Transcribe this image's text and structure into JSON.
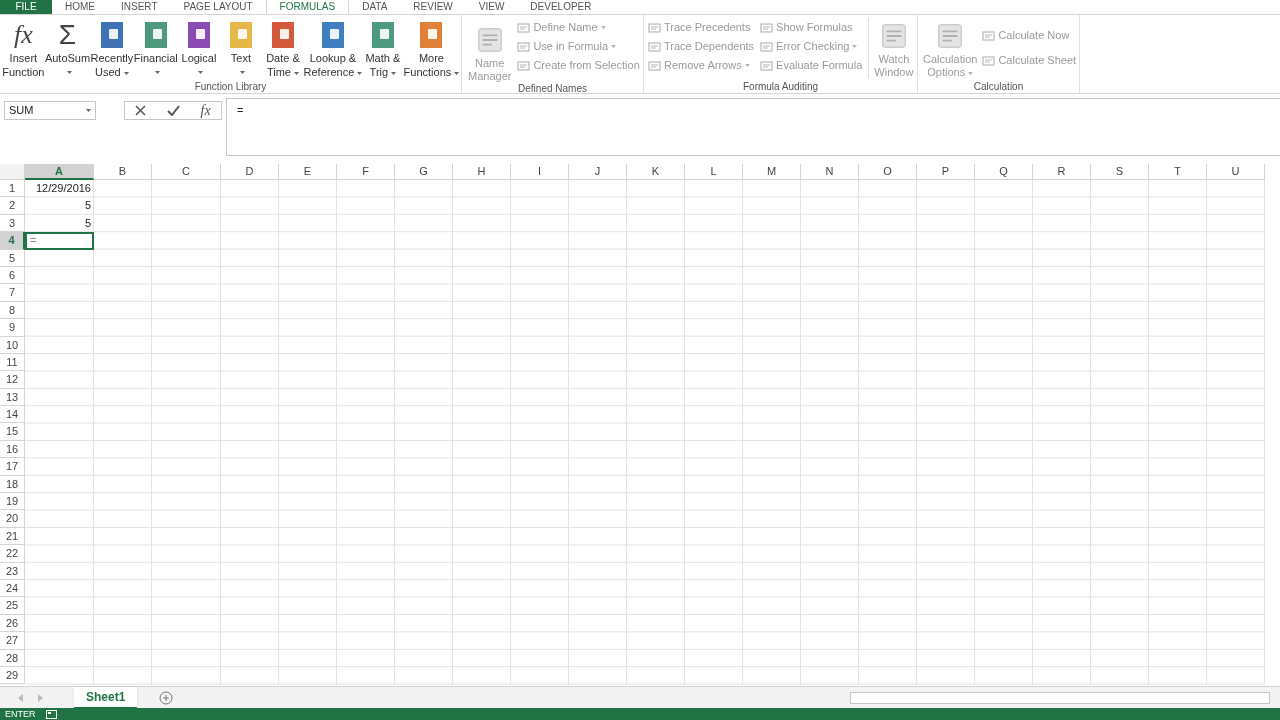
{
  "ribbon_tabs": [
    {
      "label": "FILE",
      "kind": "file",
      "selected": false
    },
    {
      "label": "HOME",
      "kind": "tab",
      "selected": false
    },
    {
      "label": "INSERT",
      "kind": "tab",
      "selected": false
    },
    {
      "label": "PAGE LAYOUT",
      "kind": "tab",
      "selected": false
    },
    {
      "label": "FORMULAS",
      "kind": "tab",
      "selected": true
    },
    {
      "label": "DATA",
      "kind": "tab",
      "selected": false
    },
    {
      "label": "REVIEW",
      "kind": "tab",
      "selected": false
    },
    {
      "label": "VIEW",
      "kind": "tab",
      "selected": false
    },
    {
      "label": "DEVELOPER",
      "kind": "tab",
      "selected": false
    }
  ],
  "function_library": {
    "title": "Function Library",
    "buttons": [
      {
        "lines": [
          "Insert",
          "Function"
        ],
        "dropdown": false,
        "kind": "function",
        "glyph": "fx"
      },
      {
        "lines": [
          "AutoSum"
        ],
        "dropdown": true,
        "kind": "sum",
        "glyph": "Σ"
      },
      {
        "lines": [
          "Recently",
          "Used"
        ],
        "dropdown": true,
        "kind": "category",
        "color": "#3f72b5"
      },
      {
        "lines": [
          "Financial"
        ],
        "dropdown": true,
        "kind": "category",
        "color": "#4e9a7e"
      },
      {
        "lines": [
          "Logical"
        ],
        "dropdown": true,
        "kind": "category",
        "color": "#8a4bb5"
      },
      {
        "lines": [
          "Text"
        ],
        "dropdown": true,
        "kind": "category",
        "color": "#e6b84a"
      },
      {
        "lines": [
          "Date &",
          "Time"
        ],
        "dropdown": true,
        "kind": "category",
        "color": "#d35a3c"
      },
      {
        "lines": [
          "Lookup &",
          "Reference"
        ],
        "dropdown": true,
        "kind": "category",
        "color": "#3f7fc0"
      },
      {
        "lines": [
          "Math &",
          "Trig"
        ],
        "dropdown": true,
        "kind": "category",
        "color": "#4e9a7e"
      },
      {
        "lines": [
          "More",
          "Functions"
        ],
        "dropdown": true,
        "kind": "category",
        "color": "#e0813a"
      }
    ]
  },
  "defined_names": {
    "title": "Defined Names",
    "large": {
      "lines": [
        "Name",
        "Manager"
      ],
      "disabled": true
    },
    "small": [
      {
        "label": "Define Name",
        "dropdown": true,
        "disabled": true
      },
      {
        "label": "Use in Formula",
        "dropdown": true,
        "disabled": true
      },
      {
        "label": "Create from Selection",
        "dropdown": false,
        "disabled": true
      }
    ]
  },
  "formula_auditing": {
    "title": "Formula Auditing",
    "small_columns": [
      [
        {
          "label": "Trace Precedents",
          "dropdown": false,
          "disabled": true
        },
        {
          "label": "Trace Dependents",
          "dropdown": false,
          "disabled": true
        },
        {
          "label": "Remove Arrows",
          "dropdown": true,
          "disabled": true
        }
      ],
      [
        {
          "label": "Show Formulas",
          "dropdown": false,
          "disabled": true
        },
        {
          "label": "Error Checking",
          "dropdown": true,
          "disabled": true
        },
        {
          "label": "Evaluate Formula",
          "dropdown": false,
          "disabled": true
        }
      ]
    ],
    "large": {
      "lines": [
        "Watch",
        "Window"
      ],
      "disabled": true
    }
  },
  "calculation": {
    "title": "Calculation",
    "large": {
      "lines": [
        "Calculation",
        "Options"
      ],
      "dropdown": true,
      "disabled": true
    },
    "small": [
      {
        "label": "Calculate Now",
        "disabled": true
      },
      {
        "label": "Calculate Sheet",
        "disabled": true
      }
    ]
  },
  "formula_bar": {
    "name_box": "SUM",
    "fx_glyph": "fx",
    "formula": "="
  },
  "columns": [
    {
      "label": "A",
      "selected": true
    },
    {
      "label": "B",
      "selected": false
    },
    {
      "label": "C",
      "selected": false
    },
    {
      "label": "D",
      "selected": false
    },
    {
      "label": "E",
      "selected": false
    },
    {
      "label": "F",
      "selected": false
    },
    {
      "label": "G",
      "selected": false
    },
    {
      "label": "H",
      "selected": false
    },
    {
      "label": "I",
      "selected": false
    },
    {
      "label": "J",
      "selected": false
    },
    {
      "label": "K",
      "selected": false
    },
    {
      "label": "L",
      "selected": false
    },
    {
      "label": "M",
      "selected": false
    },
    {
      "label": "N",
      "selected": false
    },
    {
      "label": "O",
      "selected": false
    },
    {
      "label": "P",
      "selected": false
    },
    {
      "label": "Q",
      "selected": false
    },
    {
      "label": "R",
      "selected": false
    },
    {
      "label": "S",
      "selected": false
    },
    {
      "label": "T",
      "selected": false
    },
    {
      "label": "U",
      "selected": false
    }
  ],
  "rows": [
    {
      "number": "1",
      "selected": false,
      "cell_a": {
        "value": "12/29/2016",
        "kind": "value"
      }
    },
    {
      "number": "2",
      "selected": false,
      "cell_a": {
        "value": "5",
        "kind": "value"
      }
    },
    {
      "number": "3",
      "selected": false,
      "cell_a": {
        "value": "5",
        "kind": "value"
      }
    },
    {
      "number": "4",
      "selected": true,
      "cell_a": {
        "value": "=",
        "kind": "editing"
      }
    },
    {
      "number": "5",
      "selected": false
    },
    {
      "number": "6",
      "selected": false
    },
    {
      "number": "7",
      "selected": false
    },
    {
      "number": "8",
      "selected": false
    },
    {
      "number": "9",
      "selected": false
    },
    {
      "number": "10",
      "selected": false
    },
    {
      "number": "11",
      "selected": false
    },
    {
      "number": "12",
      "selected": false
    },
    {
      "number": "13",
      "selected": false
    },
    {
      "number": "14",
      "selected": false
    },
    {
      "number": "15",
      "selected": false
    },
    {
      "number": "16",
      "selected": false
    },
    {
      "number": "17",
      "selected": false
    },
    {
      "number": "18",
      "selected": false
    },
    {
      "number": "19",
      "selected": false
    },
    {
      "number": "20",
      "selected": false
    },
    {
      "number": "21",
      "selected": false
    },
    {
      "number": "22",
      "selected": false
    },
    {
      "number": "23",
      "selected": false
    },
    {
      "number": "24",
      "selected": false
    },
    {
      "number": "25",
      "selected": false
    },
    {
      "number": "26",
      "selected": false
    },
    {
      "number": "27",
      "selected": false
    },
    {
      "number": "28",
      "selected": false
    },
    {
      "number": "29",
      "selected": false
    }
  ],
  "sheet_tabs": [
    {
      "label": "Sheet1",
      "selected": true
    }
  ],
  "status_bar": {
    "mode": "ENTER"
  }
}
